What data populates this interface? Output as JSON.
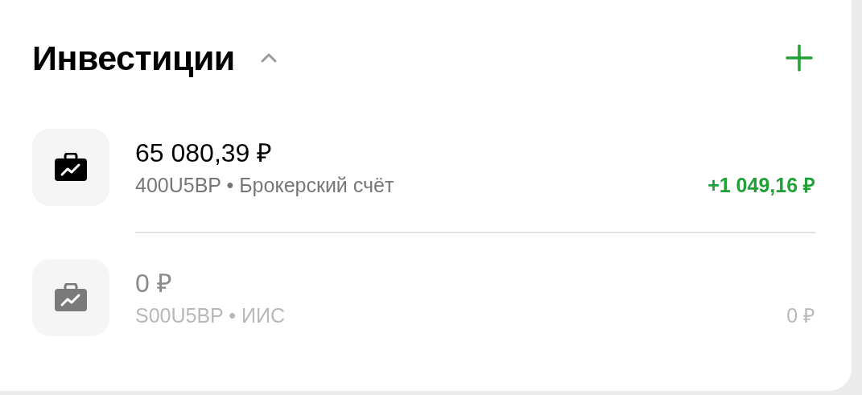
{
  "section": {
    "title": "Инвестиции",
    "expanded": true
  },
  "accounts": [
    {
      "amount": "65 080,39 ₽",
      "description": "400U5BP • Брокерский счёт",
      "change": "+1 049,16 ₽",
      "inactive": false
    },
    {
      "amount": "0 ₽",
      "description": "S00U5BP • ИИС",
      "change": "0 ₽",
      "inactive": true
    }
  ]
}
